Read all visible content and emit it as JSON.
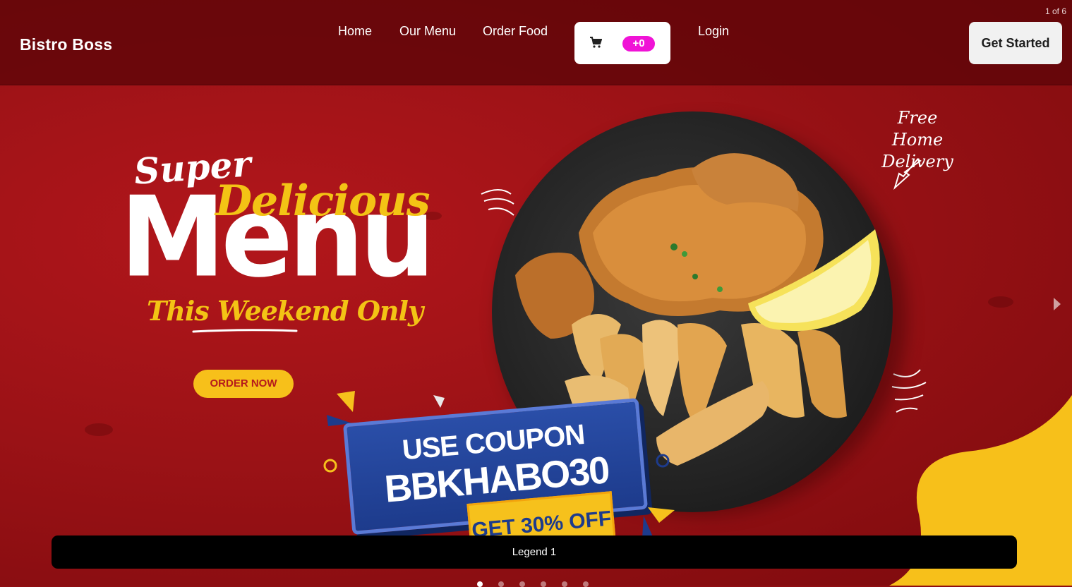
{
  "navbar": {
    "brand": "Bistro Boss",
    "links": [
      {
        "label": "Home"
      },
      {
        "label": "Our Menu"
      },
      {
        "label": "Order Food"
      },
      {
        "label": "Login"
      }
    ],
    "cart": {
      "icon": "cart-icon",
      "badge": "+0"
    },
    "cta": "Get Started"
  },
  "carousel": {
    "counter": "1 of 6",
    "legend": "Legend 1",
    "slide_count": 6,
    "active_index": 0
  },
  "slide": {
    "headline_super": "Super",
    "headline_delicious": "Delicious",
    "headline_menu": "Menu",
    "headline_weekend": "This Weekend Only",
    "order_button": "ORDER NOW",
    "free_delivery": "Free Home Delivery",
    "coupon_line1": "USE COUPON",
    "coupon_code": "BBKHABO30",
    "coupon_offer": "GET 30% OFF"
  },
  "colors": {
    "background_red": "#9b1216",
    "accent_yellow": "#f7c01a",
    "badge_magenta": "#f013d6",
    "coupon_blue": "#1d3b8c"
  }
}
